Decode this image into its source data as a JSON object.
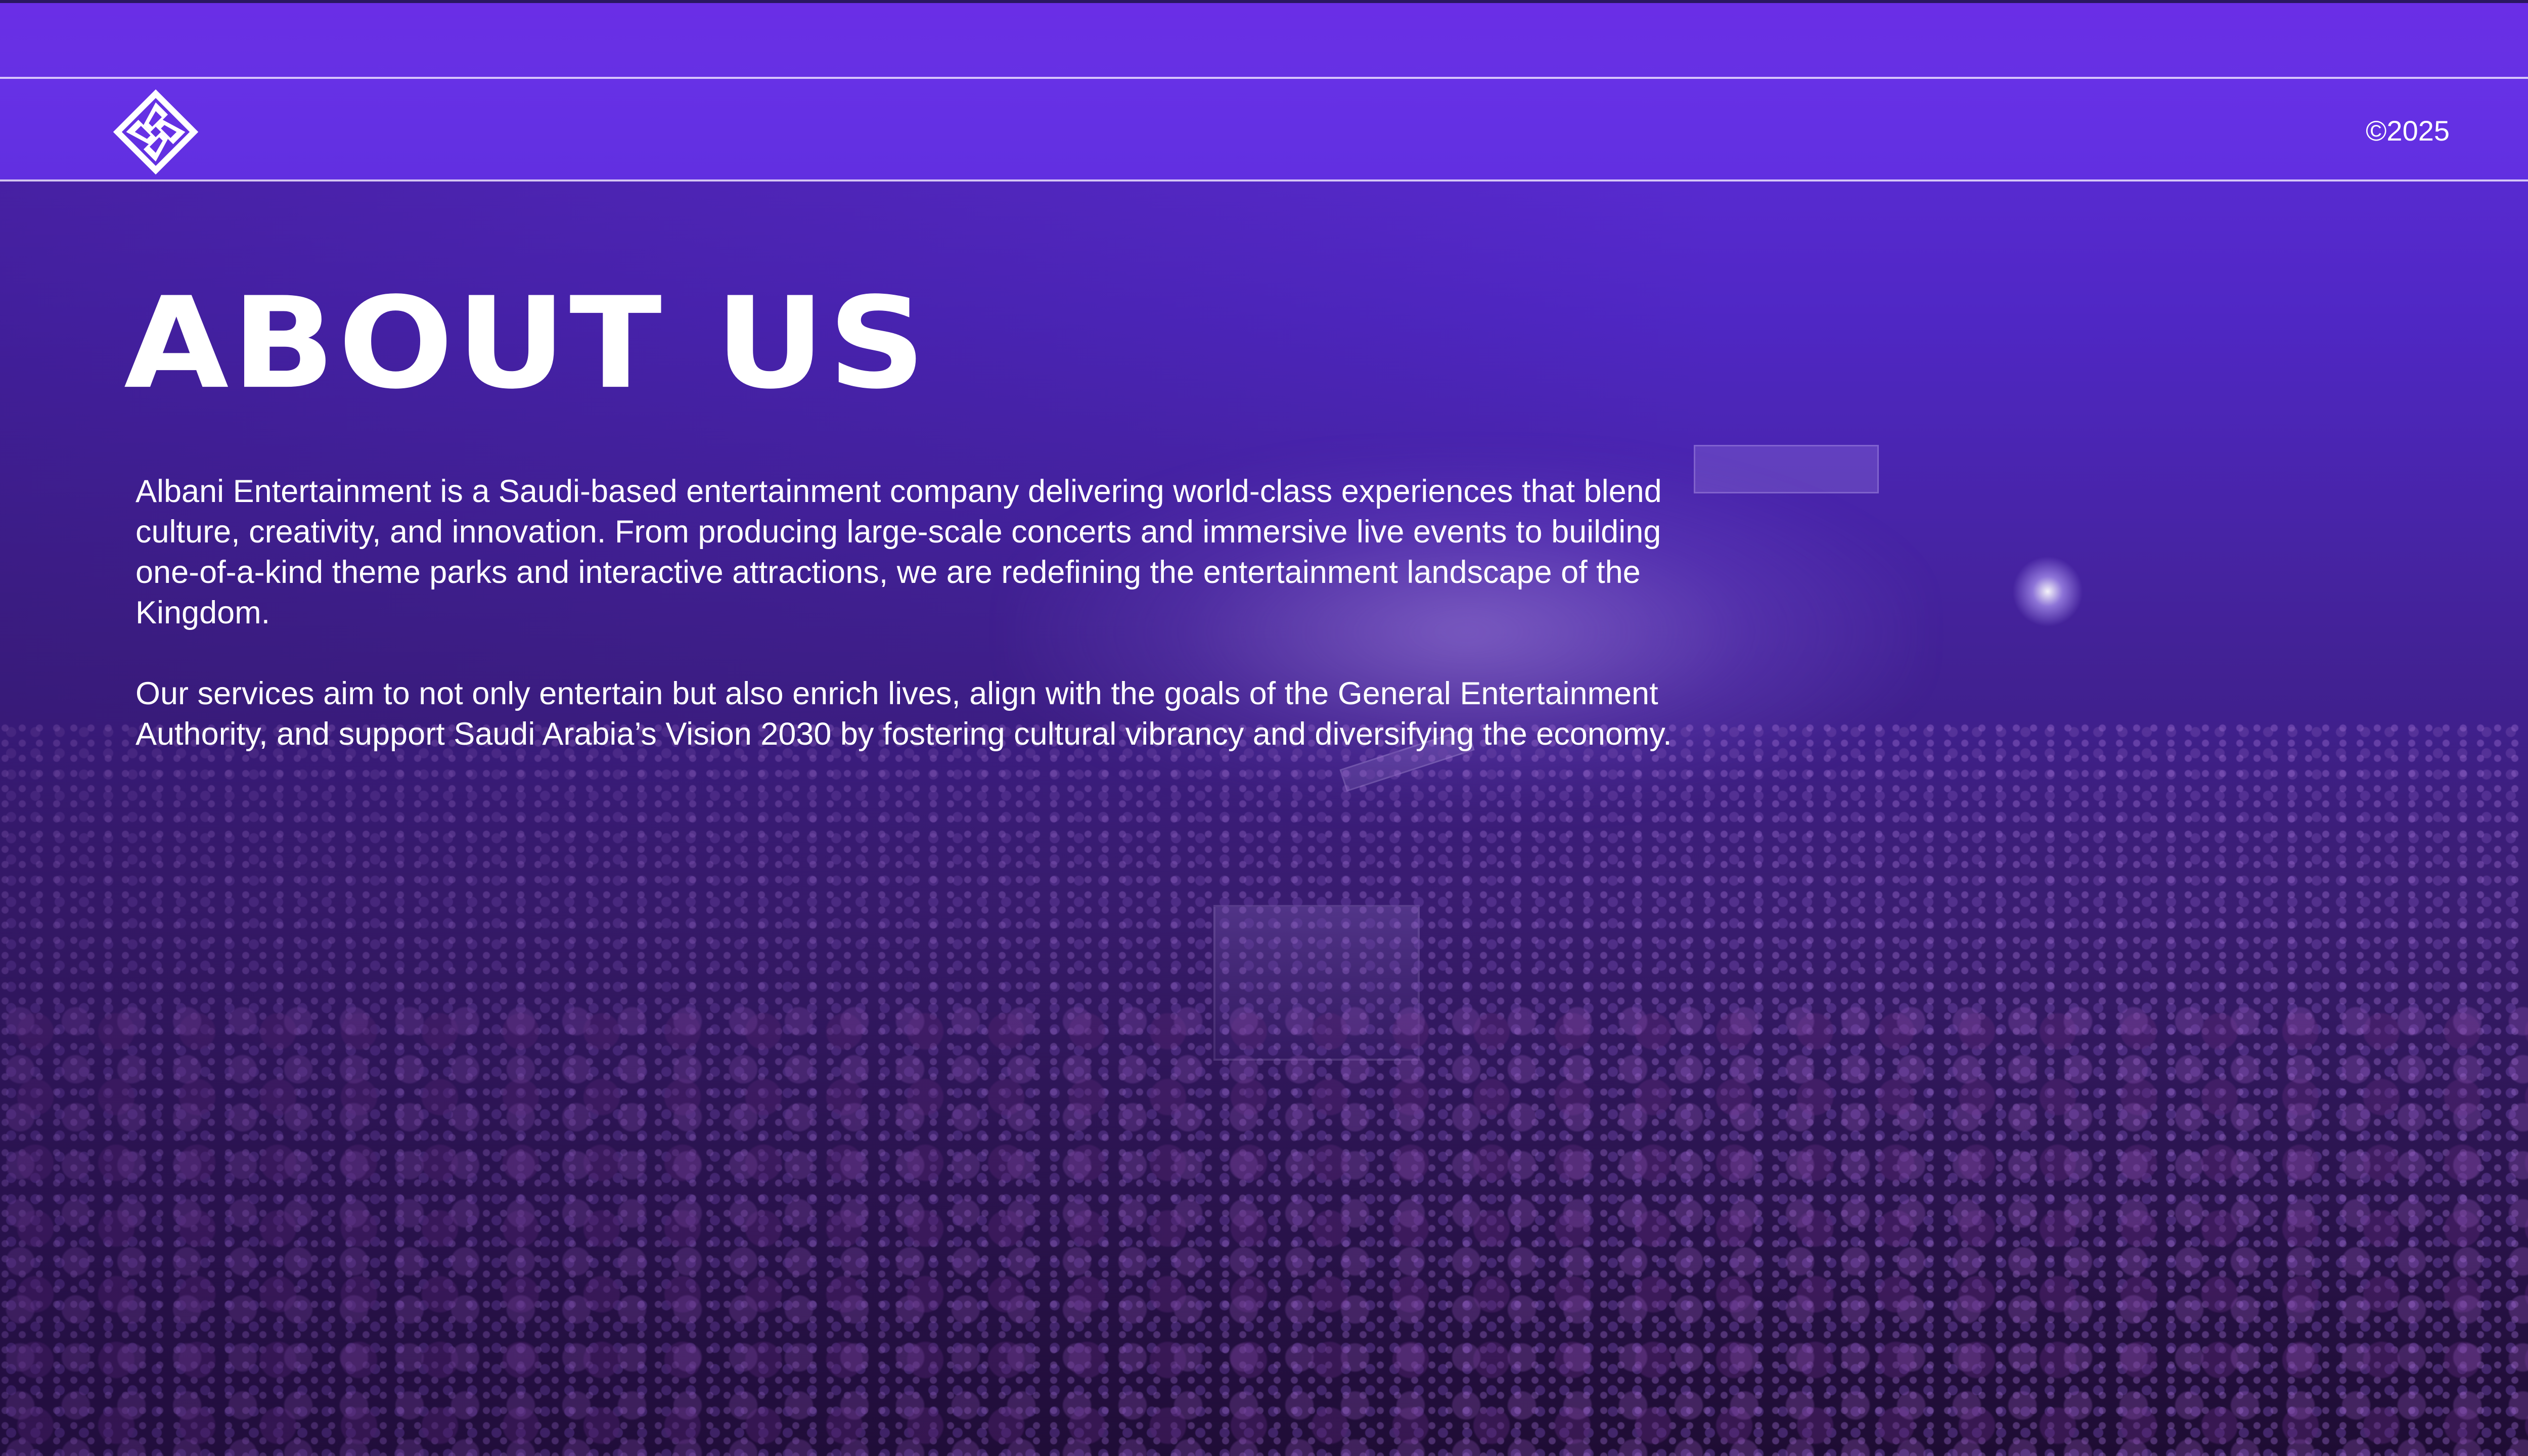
{
  "header": {
    "logo_icon": "albani-logo-icon",
    "copyright": "©2025"
  },
  "content": {
    "title": "ABOUT US",
    "paragraphs": [
      "Albani Entertainment is a Saudi-based entertainment company delivering world-class experiences that blend culture, creativity, and innovation. From producing large-scale concerts and immersive live events to building one-of-a-kind theme parks and interactive attractions, we are redefining the entertainment landscape of the Kingdom.",
      "Our services aim to not only entertain but also enrich lives, align with the goals of the General Entertainment Authority, and support Saudi Arabia’s Vision 2030 by fostering cultural vibrancy and diversifying the economy."
    ]
  },
  "colors": {
    "brand_purple": "#6a2ee6",
    "text": "#ffffff"
  }
}
